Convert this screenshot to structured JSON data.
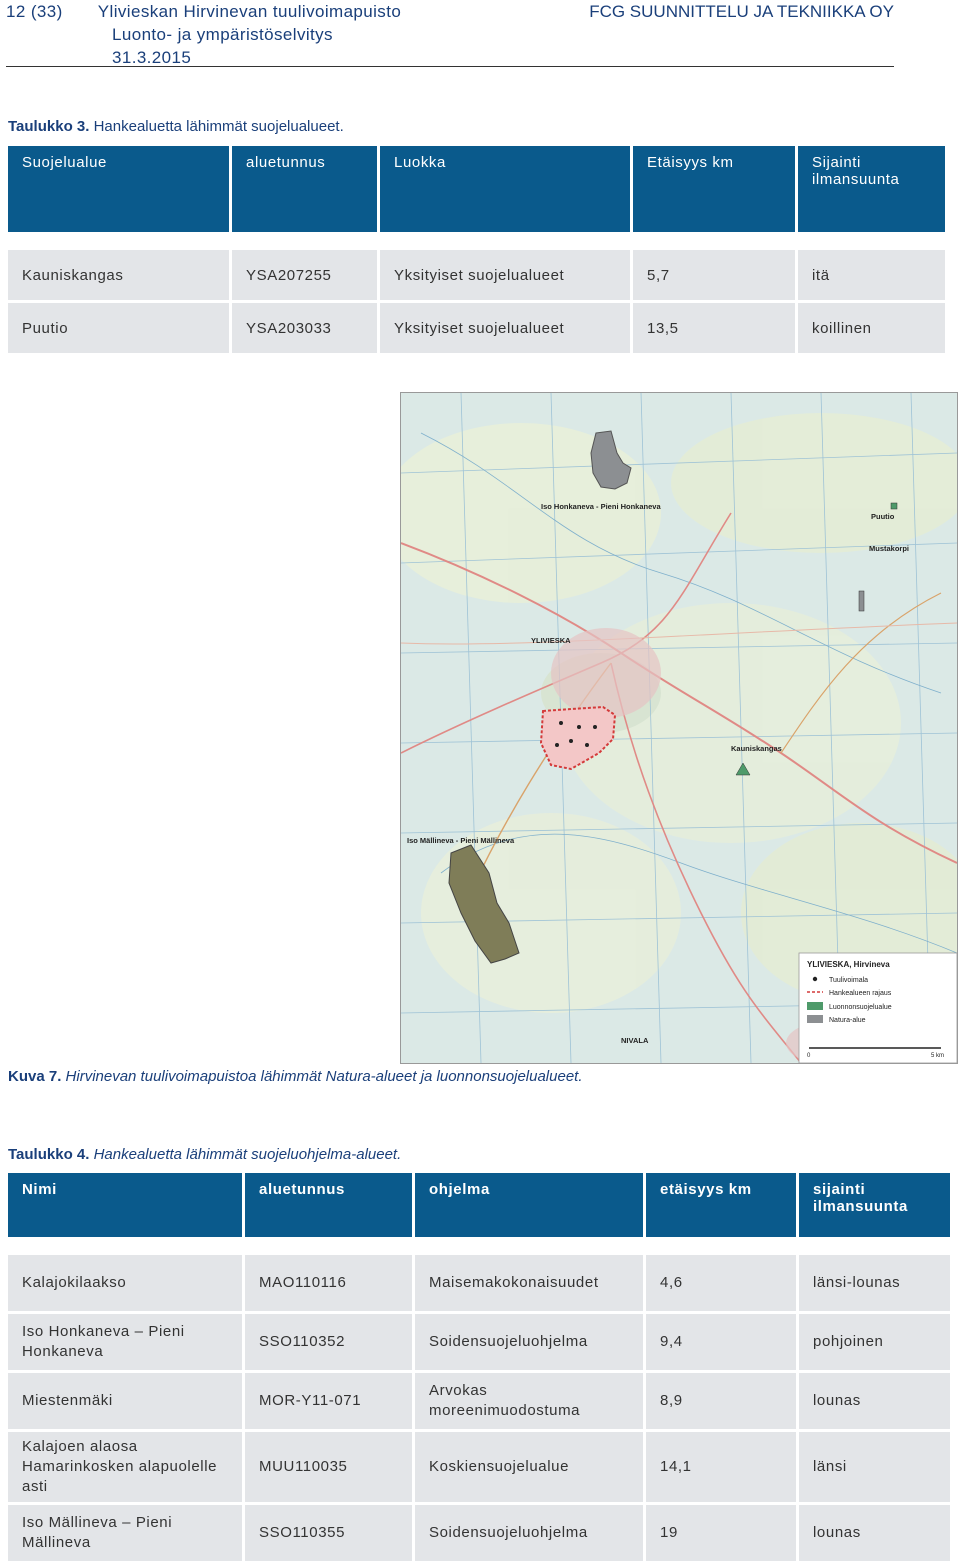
{
  "header": {
    "page": "12 (33)",
    "doc_title": "Ylivieskan Hirvinevan tuulivoimapuisto",
    "subtitle": "Luonto- ja ympäristöselvitys",
    "date": "31.3.2015",
    "company": "FCG SUUNNITTELU JA TEKNIIKKA OY"
  },
  "table3": {
    "caption_bold": "Taulukko 3.",
    "caption_text": "Hankealuetta lähimmät suojelualueet.",
    "headers": [
      "Suojelualue",
      "aluetunnus",
      "Luokka",
      "Etäisyys km",
      "Sijainti ilmansuunta"
    ],
    "rows": [
      [
        "Kauniskangas",
        "YSA207255",
        "Yksityiset suojelualueet",
        "5,7",
        "itä"
      ],
      [
        "Puutio",
        "YSA203033",
        "Yksityiset suojelualueet",
        "13,5",
        "koillinen"
      ]
    ]
  },
  "figure": {
    "caption_bold": "Kuva 7.",
    "caption_text": "Hirvinevan tuulivoimapuistoa lähimmät Natura-alueet ja luonnonsuojelualueet.",
    "labels": {
      "honkaneva": "Iso Honkaneva - Pieni Honkaneva",
      "puutio": "Puutio",
      "mustakorpi": "Mustakorpi",
      "ylivieska": "YLIVIESKA",
      "kauniskangas": "Kauniskangas",
      "mallineva": "Iso Mällineva - Pieni Mällineva",
      "nivala": "NIVALA"
    },
    "legend": {
      "title": "YLIVIESKA, Hirvineva",
      "items": [
        "Tuulivoimala",
        "Hankealueen rajaus",
        "Luonnonsuojelualue",
        "Natura-alue"
      ],
      "scale_start": "0",
      "scale_end": "5 km"
    }
  },
  "table4": {
    "caption_bold": "Taulukko 4.",
    "caption_text": "Hankealuetta lähimmät suojeluohjelma-alueet.",
    "headers": [
      "Nimi",
      "aluetunnus",
      "ohjelma",
      "etäisyys km",
      "sijainti ilmansuunta"
    ],
    "rows": [
      [
        "Kalajokilaakso",
        "MAO110116",
        "Maisemakokonaisuudet",
        "4,6",
        "länsi-lounas"
      ],
      [
        "Iso Honkaneva – Pieni Honkaneva",
        "SSO110352",
        "Soidensuojeluohjelma",
        "9,4",
        "pohjoinen"
      ],
      [
        "Miestenmäki",
        "MOR-Y11-071",
        "Arvokas moreenimuodostuma",
        "8,9",
        "lounas"
      ],
      [
        "Kalajoen alaosa Hamarinkosken alapuolelle asti",
        "MUU110035",
        "Koskiensuojelualue",
        "14,1",
        "länsi"
      ],
      [
        "Iso Mällineva – Pieni Mällineva",
        "SSO110355",
        "Soidensuojeluohjelma",
        "19",
        "lounas"
      ]
    ]
  },
  "colors": {
    "header_blue": "#0a5a8c",
    "row_gray": "#e3e5e8",
    "natura_gray": "#8c8f92",
    "natura_olive": "#7f7d58",
    "protection_green": "#4e9a6a",
    "project_red": "#d43a3a"
  }
}
